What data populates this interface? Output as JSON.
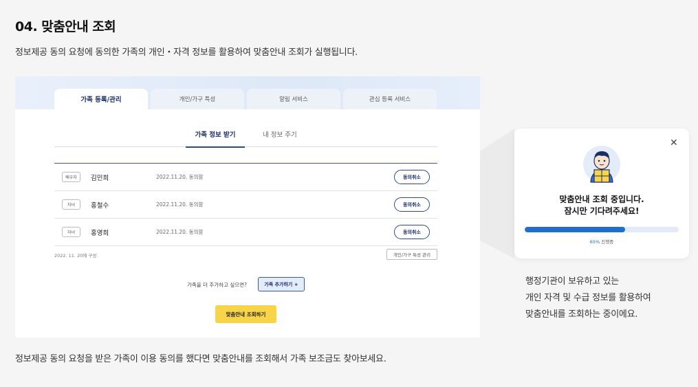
{
  "section_title": "04. 맞춤안내 조회",
  "description": "정보제공 동의 요청에 동의한 가족의 개인・자격 정보를 활용하여 맞춤안내 조회가 실행됩니다.",
  "footer_description": "정보제공 동의 요청을 받은 가족이 이용 동의를 했다면 맞춤안내를 조회해서 가족 보조금도 찾아보세요.",
  "top_tabs": [
    {
      "label": "가족 등록/관리",
      "active": true
    },
    {
      "label": "개인/가구 특성",
      "active": false
    },
    {
      "label": "알림 서비스",
      "active": false
    },
    {
      "label": "관심 등록 서비스",
      "active": false
    }
  ],
  "sub_tabs": [
    {
      "label": "가족 정보 받기",
      "active": true
    },
    {
      "label": "내 정보 주기",
      "active": false
    }
  ],
  "family_rows": [
    {
      "relation": "배우자",
      "name": "김민희",
      "status": "2022.11.20. 동의함",
      "action": "동의취소"
    },
    {
      "relation": "자녀",
      "name": "홍철수",
      "status": "2022.11.20. 동의함",
      "action": "동의취소"
    },
    {
      "relation": "자녀",
      "name": "홍영희",
      "status": "2022.11.20. 동의함",
      "action": "동의취소"
    }
  ],
  "config_date": "2022. 11. 20에 구성",
  "manage_button": "개인/가구 특성 관리",
  "add_question": "가족을 더 추가하고 싶으면?",
  "add_button": "가족 추가하기 +",
  "query_button": "맞춤안내 조회하기",
  "popup": {
    "close_icon": "close-icon",
    "message_line1": "맞춤안내 조회 중입니다.",
    "message_line2": "잠시만 기다려주세요!",
    "progress_percent": 65,
    "progress_value": "65%",
    "progress_suffix": " 진행중"
  },
  "side_text": [
    "행정기관이 보유하고 있는",
    "개인 자격 및 수급 정보를 활용하여",
    "맞춤안내를 조회하는 중이에요."
  ],
  "colors": {
    "accent": "#1a2e6b",
    "progress": "#1f6fcb",
    "query_button": "#f8d449",
    "background": "#f5f5f5"
  }
}
